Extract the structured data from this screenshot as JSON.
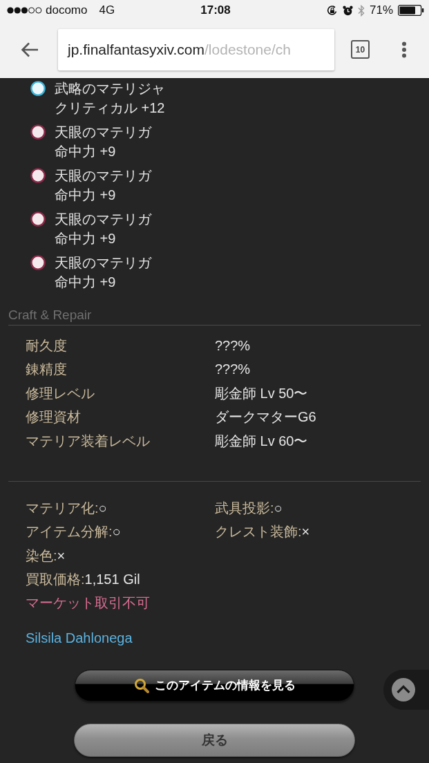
{
  "status_bar": {
    "carrier": "docomo",
    "network": "4G",
    "time": "17:08",
    "battery": "71%"
  },
  "browser": {
    "url_host": "jp.finalfantasyxiv.com",
    "url_path": "/lodestone/ch",
    "tab_count": "10"
  },
  "materia": [
    {
      "name": "武略のマテリジャ",
      "effect": "クリティカル +12",
      "color": "#3fb3d6"
    },
    {
      "name": "天眼のマテリガ",
      "effect": "命中力 +9",
      "color": "#8e2a4a"
    },
    {
      "name": "天眼のマテリガ",
      "effect": "命中力 +9",
      "color": "#8e2a4a"
    },
    {
      "name": "天眼のマテリガ",
      "effect": "命中力 +9",
      "color": "#8e2a4a"
    },
    {
      "name": "天眼のマテリガ",
      "effect": "命中力 +9",
      "color": "#8e2a4a"
    }
  ],
  "craft_repair": {
    "title": "Craft & Repair",
    "rows": [
      {
        "label": "耐久度",
        "value": "???%"
      },
      {
        "label": "錬精度",
        "value": "???%"
      },
      {
        "label": "修理レベル",
        "value": "彫金師 Lv 50〜"
      },
      {
        "label": "修理資材",
        "value": "ダークマターG6"
      },
      {
        "label": "マテリア装着レベル",
        "value": "彫金師 Lv 60〜"
      }
    ]
  },
  "item_properties": {
    "flags": [
      {
        "label": "マテリア化:",
        "value": "○"
      },
      {
        "label": "武具投影:",
        "value": "○"
      },
      {
        "label": "アイテム分解:",
        "value": "○"
      },
      {
        "label": "クレスト装飾:",
        "value": "×"
      },
      {
        "label": "染色:",
        "value": "×"
      }
    ],
    "sell_price": {
      "label": "買取価格:",
      "value": "1,151 Gil"
    },
    "market_note": "マーケット取引不可"
  },
  "crafter": "Silsila Dahlonega",
  "buttons": [
    {
      "kind": "info",
      "label": "このアイテムの情報を見る"
    },
    {
      "kind": "back",
      "label": "戻る"
    }
  ]
}
